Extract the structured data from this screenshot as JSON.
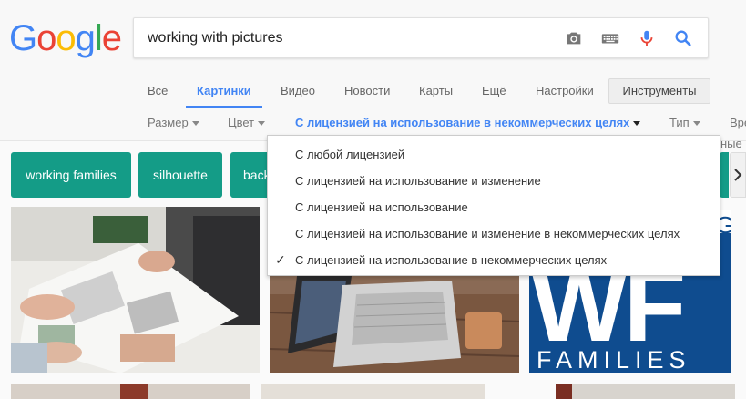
{
  "logo": {
    "letters": [
      "G",
      "o",
      "o",
      "g",
      "l",
      "e"
    ]
  },
  "search": {
    "value": "working with pictures"
  },
  "icons": {
    "camera": "camera-icon",
    "keyboard": "keyboard-icon",
    "mic": "microphone-icon",
    "search": "search-icon"
  },
  "tabs": [
    {
      "label": "Все"
    },
    {
      "label": "Картинки"
    },
    {
      "label": "Видео"
    },
    {
      "label": "Новости"
    },
    {
      "label": "Карты"
    },
    {
      "label": "Ещё"
    },
    {
      "label": "Настройки"
    }
  ],
  "tools_button": "Инструменты",
  "filters": [
    {
      "label": "Размер"
    },
    {
      "label": "Цвет"
    },
    {
      "label": "С лицензией на использование в некоммерческих целях"
    },
    {
      "label": "Тип"
    },
    {
      "label": "Вре"
    }
  ],
  "right_partial_text": "ные",
  "chips": [
    {
      "label": "working families"
    },
    {
      "label": "silhouette"
    },
    {
      "label": "back"
    }
  ],
  "license_menu": {
    "selected_index": 4,
    "check_symbol": "✓",
    "options": [
      "С любой лицензией",
      "С лицензией на использование и изменение",
      "С лицензией на использование",
      "С лицензией на использование и изменение в некоммерческих целях",
      "С лицензией на использование в некоммерческих целях"
    ]
  },
  "image_text": {
    "wf": "WF",
    "families": "FAMILIES",
    "g": "G"
  },
  "colors": {
    "accent": "#4285f4",
    "chip": "#149c87",
    "wf_blue": "#0f4c8f"
  }
}
